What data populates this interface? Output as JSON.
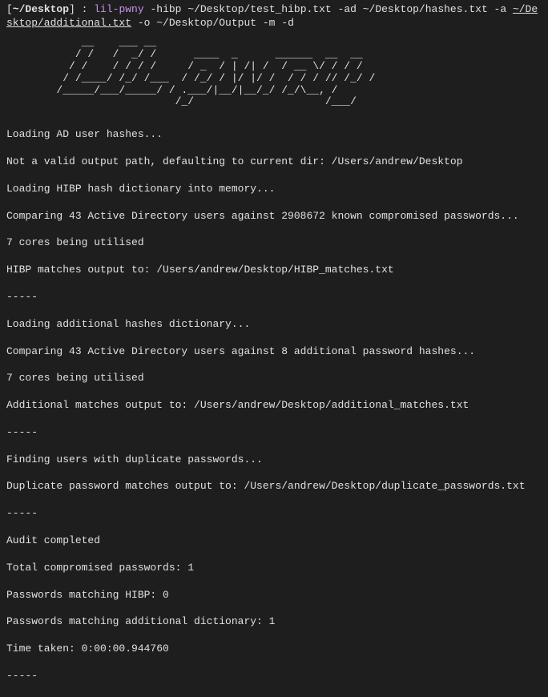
{
  "prompt": {
    "open_bracket": "[",
    "path": "~/Desktop",
    "close_bracket": "]",
    "separator": " : ",
    "command": "lil-pwny",
    "args_part1": " -hibp ~/Desktop/test_hibp.txt -ad ~/Desktop/hashes.txt -a ",
    "args_underlined1": "~/Desktop/additional.txt",
    "args_part2": " -o ~/Desktop/Output -m -d"
  },
  "ascii_art": "            __    ___ __                             \n           / /   /  _/ /      ____  _      ______  __  __\n          / /    / / / /     / _  / | /| /  / __ \\/ / / /\n         / /____/ /_/ /___  / /_/ / |/ |/ /  / / / // /_/ /\n        /_____/___/_____/ / .___/|__/|__/_/ /_/\\__, /\n                           /_/                     /___/",
  "output": {
    "lines": [
      "Loading AD user hashes...",
      "Not a valid output path, defaulting to current dir: /Users/andrew/Desktop",
      "Loading HIBP hash dictionary into memory...",
      "Comparing 43 Active Directory users against 2908672 known compromised passwords...",
      "7 cores being utilised",
      "HIBP matches output to: /Users/andrew/Desktop/HIBP_matches.txt",
      "-----",
      "Loading additional hashes dictionary...",
      "Comparing 43 Active Directory users against 8 additional password hashes...",
      "7 cores being utilised",
      "Additional matches output to: /Users/andrew/Desktop/additional_matches.txt",
      "-----",
      "Finding users with duplicate passwords...",
      "Duplicate password matches output to: /Users/andrew/Desktop/duplicate_passwords.txt",
      "-----",
      "Audit completed",
      "Total compromised passwords: 1",
      "Passwords matching HIBP: 0",
      "Passwords matching additional dictionary: 1",
      "Time taken: 0:00:00.944760",
      "-----"
    ]
  }
}
